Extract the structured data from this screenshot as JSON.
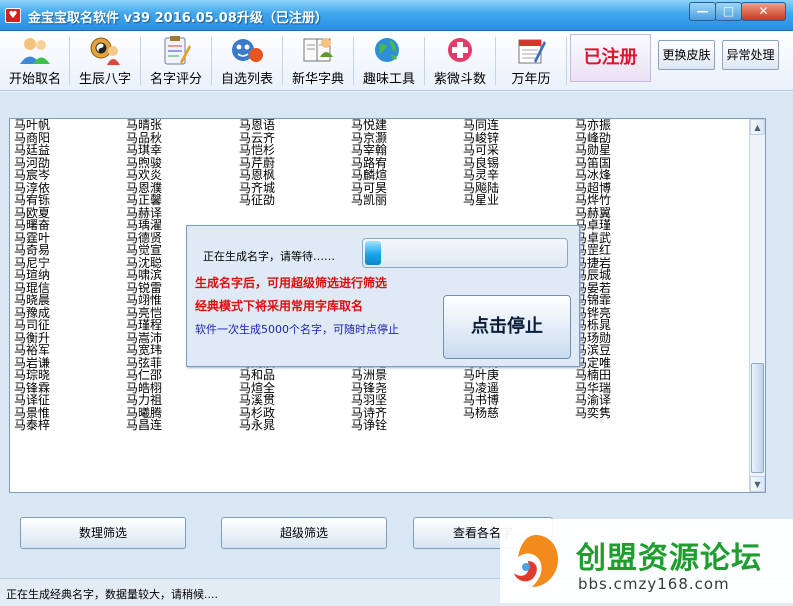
{
  "window": {
    "title": "金宝宝取名软件 v39   2016.05.08升级（已注册）",
    "min_glyph": "—",
    "max_glyph": "□",
    "close_glyph": "✕"
  },
  "toolbar": {
    "items": [
      {
        "label": "开始取名",
        "icon": "people-icon"
      },
      {
        "label": "生辰八字",
        "icon": "bagua-icon"
      },
      {
        "label": "名字评分",
        "icon": "clipboard-icon"
      },
      {
        "label": "自选列表",
        "icon": "face-icon"
      },
      {
        "label": "新华字典",
        "icon": "book-icon"
      },
      {
        "label": "趣味工具",
        "icon": "globe-icon"
      },
      {
        "label": "紫微斗数",
        "icon": "medical-cross-icon"
      },
      {
        "label": "万年历",
        "icon": "calendar-icon"
      }
    ],
    "registered": "已注册",
    "skin_button": "更换皮肤",
    "error_button": "异常处理"
  },
  "name_columns": [
    [
      "马叶帆",
      "马商阳",
      "马廷益",
      "马河劭",
      "马宸岑",
      "马淳依",
      "马宥铄",
      "马欧夏",
      "马曙奋",
      "马霆叶",
      "马奇易",
      "马尼宁",
      "马瑄纳",
      "马琨信",
      "马晓晨",
      "马豫成",
      "马司征",
      "马衡升",
      "马裕军",
      "马岩谦",
      "马琮晓",
      "马锋霖",
      "马译征",
      "马景惟",
      "马泰梓"
    ],
    [
      "马晴张",
      "马品秋",
      "马琪幸",
      "马煦骏",
      "马欢炎",
      "马恩濮",
      "马正馨",
      "马赫译",
      "马瑀濯",
      "马德贤",
      "马觉宣",
      "马沈聪",
      "马啸滨",
      "马锐雷",
      "马翊惟",
      "马亮恺",
      "马瑾程",
      "马嵩沛",
      "马宽玮",
      "马弦菲",
      "马仁邵",
      "马皓栩",
      "马力祖",
      "马曦腾",
      "马昌连"
    ],
    [
      "马恩语",
      "马云齐",
      "马恺杉",
      "马芹蔚",
      "马恩枫",
      "马齐城",
      "马征劭",
      "",
      "",
      "",
      "",
      "",
      "",
      "",
      "",
      "",
      "",
      "马景毅",
      "马茂尼",
      "马则溟",
      "马和品",
      "马煊全",
      "马溪贯",
      "马杉政",
      "马永晁"
    ],
    [
      "马悦建",
      "马京灏",
      "马宰翰",
      "马路宥",
      "马麟煊",
      "马可昊",
      "马凯丽",
      "",
      "",
      "",
      "",
      "",
      "",
      "",
      "",
      "",
      "",
      "马学声",
      "马羿铄",
      "马江瑨",
      "马洲景",
      "马锋尧",
      "马羽坚",
      "马诗齐",
      "马诤铨"
    ],
    [
      "马同连",
      "马峻锌",
      "马可采",
      "马良锡",
      "马灵辛",
      "马飚陆",
      "马星业",
      "",
      "",
      "",
      "",
      "",
      "",
      "",
      "",
      "",
      "",
      "马溢锌",
      "马民路",
      "马乐树",
      "马叶庚",
      "马凌遥",
      "马书博",
      "马杨慈",
      ""
    ],
    [
      "马亦振",
      "马峰劭",
      "马勋星",
      "马笛国",
      "马冰烽",
      "马超博",
      "马烨竹",
      "马赫翼",
      "马卓瑾",
      "马卓武",
      "马罡红",
      "马捷岩",
      "马辰城",
      "马晏若",
      "马锦霏",
      "马铧亮",
      "马栎晁",
      "马玚勋",
      "马滨豆",
      "马定唯",
      "马楠田",
      "马华瑞",
      "马渝译",
      "马奕隽",
      ""
    ]
  ],
  "progress": {
    "status": "正在生成名字，请等待……",
    "fraction": 0.08
  },
  "dialog": {
    "note1": "生成名字后，可用超级筛选进行筛选",
    "note2": "经典模式下将采用常用字库取名",
    "note3": "软件一次生成5000个名字，可随时点停止",
    "stop_button": "点击停止"
  },
  "bottom": {
    "btn1": "数理筛选",
    "btn2": "超级筛选",
    "btn3": "查看各名字"
  },
  "statusbar": {
    "text": "正在生成经典名字，数据量较大，请稍候...."
  },
  "watermark": {
    "title": "创盟资源论坛",
    "url": "bbs.cmzy168.com"
  },
  "colors": {
    "titlebar": "#3fa7ee",
    "registered_text": "#e0142d",
    "dialog_red": "#dc0f0f",
    "dialog_blue": "#1a1fb0",
    "progress_fill": "#18a5ea",
    "watermark_green": "#1f9e2f"
  }
}
